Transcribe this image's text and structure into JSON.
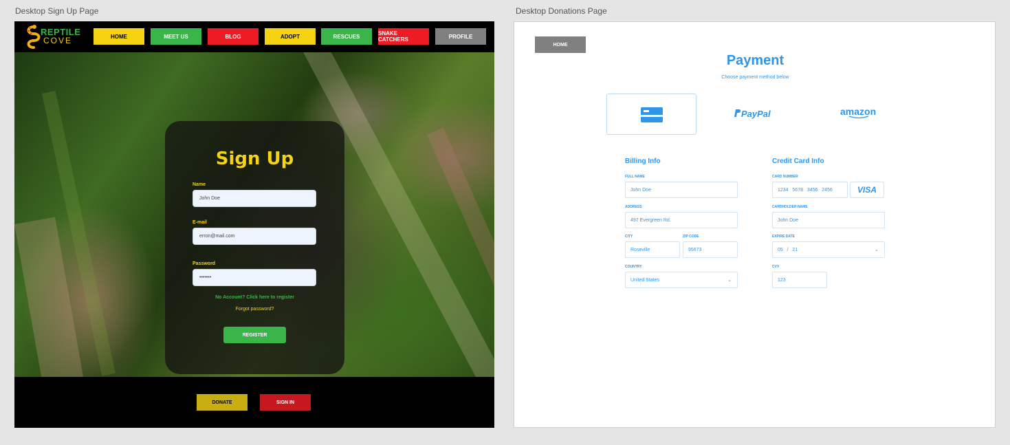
{
  "artboards": {
    "signup_label": "Desktop Sign Up Page",
    "donations_label": "Desktop Donations Page"
  },
  "signup": {
    "logo": {
      "line1": "REPTILE",
      "line2": "COVE"
    },
    "nav": [
      {
        "label": "HOME",
        "color": "#f5d313",
        "text": "#000000"
      },
      {
        "label": "MEET US",
        "color": "#3ab54a",
        "text": "#ffffff"
      },
      {
        "label": "BLOG",
        "color": "#ed1c24",
        "text": "#ffffff"
      },
      {
        "label": "ADOPT",
        "color": "#f5d313",
        "text": "#000000"
      },
      {
        "label": "RESCUES",
        "color": "#3ab54a",
        "text": "#ffffff"
      },
      {
        "label": "SNAKE CATCHERS",
        "color": "#ed1c24",
        "text": "#ffffff"
      },
      {
        "label": "PROFILE",
        "color": "#808080",
        "text": "#ffffff"
      }
    ],
    "title": "Sign Up",
    "name_label": "Name",
    "name_value": "John Doe",
    "email_label": "E-mail",
    "email_value": "erron@mail.com",
    "password_label": "Password",
    "password_value": "•••••••",
    "no_account_link": "No Account? Click here to register",
    "forgot_link": "Forgot password?",
    "register_button": "REGISTER",
    "donate_button": "DONATE",
    "signin_button": "SIGN IN"
  },
  "donations": {
    "home_button": "HOME",
    "title": "Payment",
    "subtitle": "Choose payment method below",
    "methods": {
      "paypal": "PayPal",
      "amazon": "amazon",
      "card_icon": "credit-card-icon"
    },
    "billing": {
      "title": "Billing Info",
      "full_name_label": "FULL NAME",
      "full_name_value": "John Doe",
      "address_label": "ADDRESS",
      "address_value": "497 Evergreen Rd.",
      "city_label": "CITY",
      "city_value": "Roseville",
      "zip_label": "ZIP CODE",
      "zip_value": "95673",
      "country_label": "COUNTRY",
      "country_value": "United States"
    },
    "card": {
      "title": "Credit Card Info",
      "number_label": "CARD NUMBER",
      "number_value": "1234   5678   3456   2456",
      "brand": "VISA",
      "holder_label": "CARDHOLDER NAME",
      "holder_value": "John Doe",
      "expire_label": "EXPIRE DATE",
      "expire_value": "05   /   21",
      "cvv_label": "CVV",
      "cvv_value": "123"
    }
  },
  "colors": {
    "yellow": "#f5d313",
    "green": "#3ab54a",
    "red": "#ed1c24",
    "gray": "#808080",
    "blue": "#2e95e8"
  }
}
